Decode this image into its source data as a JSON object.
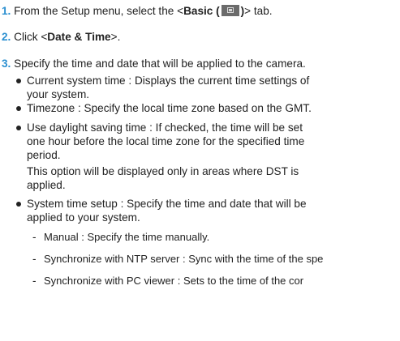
{
  "steps": [
    {
      "number": "1.",
      "prefix": "From the Setup menu, select the <",
      "bold_label": "Basic (",
      "icon_label": "basic-setup-icon",
      "after_icon": ")",
      "suffix": "> tab."
    },
    {
      "number": "2.",
      "prefix": "Click <",
      "bold_label": "Date & Time",
      "suffix": ">."
    },
    {
      "number": "3.",
      "text": "Specify the time and date that will be applied to the camera."
    }
  ],
  "bullets": [
    {
      "lines": [
        "Current system time : Displays the current time settings of",
        "your system."
      ]
    },
    {
      "lines": [
        "Timezone : Specify the local time zone based on the GMT."
      ]
    },
    {
      "lines": [
        "Use daylight saving time : If checked, the time will be set",
        "one hour before the local time zone for the specified time",
        "period.",
        "This option will be displayed only in areas where DST is",
        "applied."
      ]
    },
    {
      "lines": [
        "System time setup : Specify the time and date that will be",
        "applied to your system."
      ]
    }
  ],
  "subitems": [
    {
      "dash": "-",
      "text": "Manual : Specify the time manually."
    },
    {
      "dash": "-",
      "text": "Synchronize with NTP server : Sync with the time of the spe"
    },
    {
      "dash": "-",
      "text": "Synchronize with PC viewer : Sets to the time of the cor"
    }
  ],
  "colors": {
    "step_number": "#2a8fd0",
    "text": "#222222",
    "icon": "#6b6b6b"
  }
}
